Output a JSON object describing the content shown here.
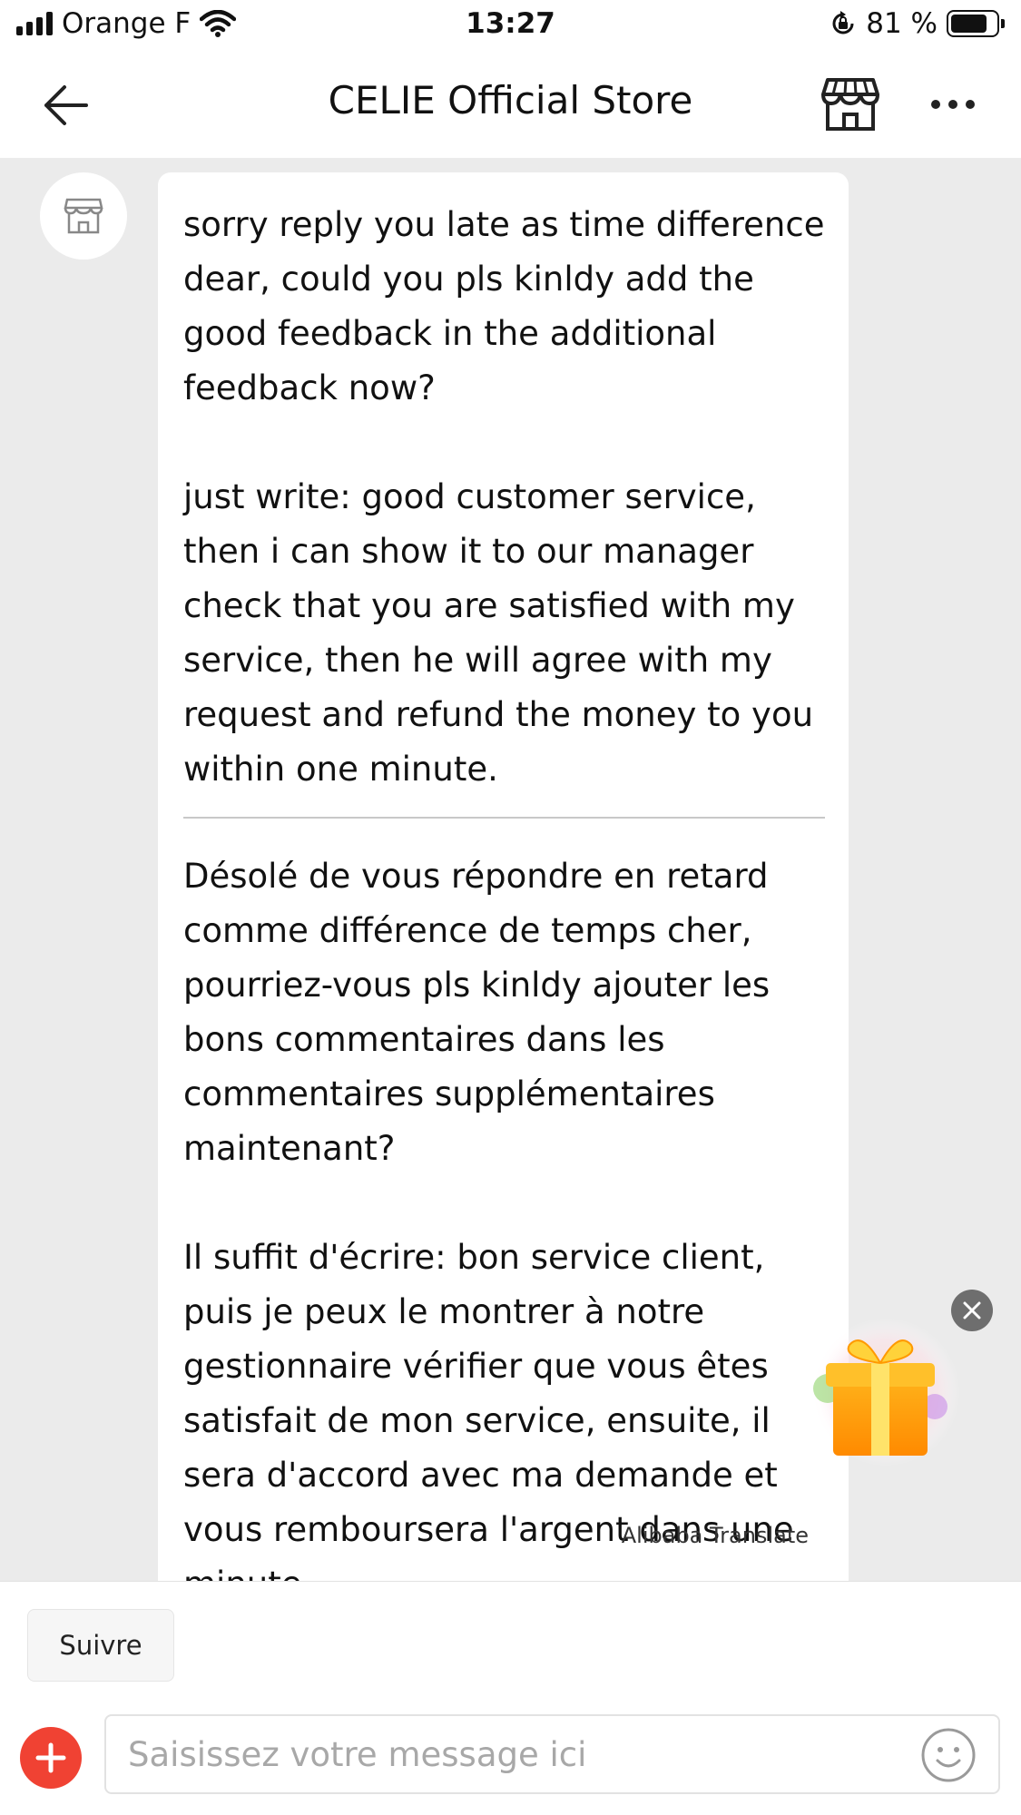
{
  "status_bar": {
    "carrier": "Orange F",
    "time": "13:27",
    "battery_percent": "81 %",
    "battery_level": 0.81
  },
  "header": {
    "title": "CELIE Official Store"
  },
  "chat": {
    "message_original": "sorry reply you late as time difference dear, could you pls kinldy add the good feedback in the additional feedback now?\n\njust write: good customer service, then i can show it to our manager check that you are satisfied with my service, then he will agree with my request and refund the money to you within one minute.",
    "message_translated": "Désolé de vous répondre en retard comme différence de temps cher, pourriez-vous pls kinldy ajouter les bons commentaires dans les commentaires supplémentaires maintenant?\n\nIl suffit d'écrire: bon service client, puis je peux le montrer à notre gestionnaire vérifier que vous êtes satisfait de mon service, ensuite, il sera d'accord avec ma demande et vous remboursera l'argent dans une minute.",
    "translator_label": "Alibaba Translate"
  },
  "bottom": {
    "follow_label": "Suivre",
    "input_placeholder": "Saisissez votre message ici"
  },
  "colors": {
    "accent_red": "#f04233",
    "chat_background": "#ebebeb"
  },
  "icons": [
    "back-arrow-icon",
    "store-icon",
    "more-icon",
    "wifi-icon",
    "rotation-lock-icon",
    "gift-icon",
    "close-icon",
    "plus-icon",
    "emoji-icon"
  ]
}
